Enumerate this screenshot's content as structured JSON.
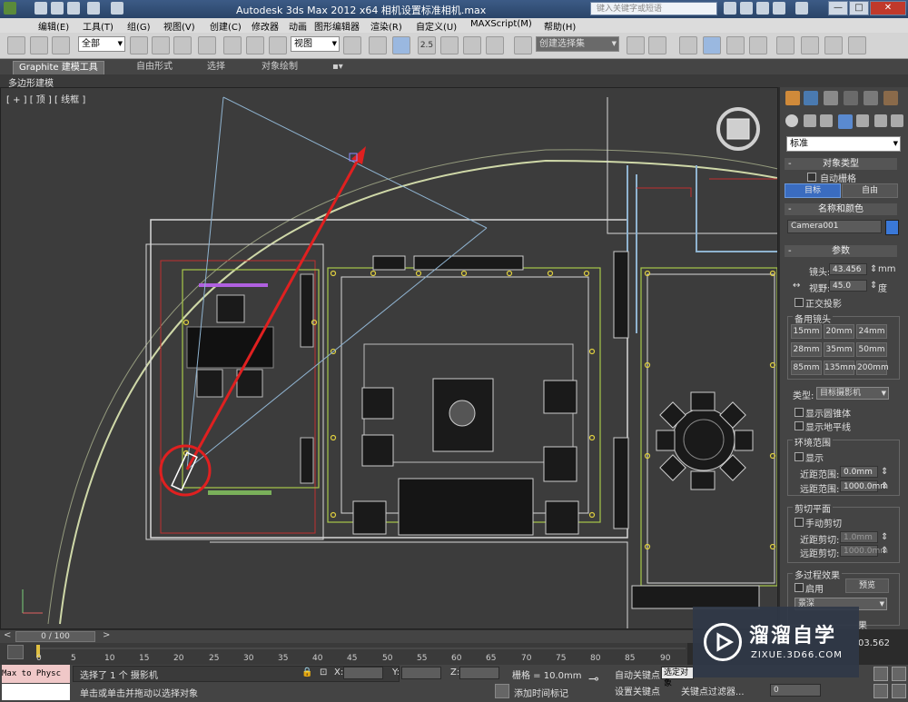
{
  "window": {
    "title": "Autodesk 3ds Max  2012 x64      相机设置标准相机.max",
    "search_placeholder": "键入关键字或短语",
    "controls": [
      "—",
      "□",
      "✕"
    ]
  },
  "menu": [
    "编辑(E)",
    "工具(T)",
    "组(G)",
    "视图(V)",
    "创建(C)",
    "修改器",
    "动画",
    "图形编辑器",
    "渲染(R)",
    "自定义(U)",
    "MAXScript(M)",
    "帮助(H)"
  ],
  "toolbar": {
    "selection_filter": "全部",
    "reference_coord": "视图",
    "snap_angle": "2.5",
    "named_selection": "创建选择集"
  },
  "ribbon": {
    "tabs": [
      "Graphite 建模工具",
      "自由形式",
      "选择",
      "对象绘制"
    ],
    "sub_label": "多边形建模"
  },
  "viewport": {
    "label": "[ + ] [ 顶 ] [ 线框 ]"
  },
  "command_panel": {
    "dropdown": "标准",
    "object_type_header": "对象类型",
    "autogrid": "自动栅格",
    "btn_target": "目标",
    "btn_free": "自由",
    "name_color_header": "名称和颜色",
    "camera_name": "Camera001",
    "params_header": "参数",
    "lens_label": "镜头:",
    "lens_value": "43.456",
    "lens_unit": "mm",
    "fov_label": "视野:",
    "fov_value": "45.0",
    "fov_unit": "度",
    "ortho": "正交投影",
    "stock_lenses": "备用镜头",
    "lenses": [
      "15mm",
      "20mm",
      "24mm",
      "28mm",
      "35mm",
      "50mm",
      "85mm",
      "135mm",
      "200mm"
    ],
    "type_label": "类型:",
    "type_value": "目标摄影机",
    "show_cone": "显示圆锥体",
    "show_horizon": "显示地平线",
    "env_ranges": "环境范围",
    "env_show": "显示",
    "near_range_label": "近距范围:",
    "near_range_value": "0.0mm",
    "far_range_label": "远距范围:",
    "far_range_value": "1000.0mm",
    "clip_planes": "剪切平面",
    "manual_clip": "手动剪切",
    "near_clip_label": "近距剪切:",
    "near_clip_value": "1.0mm",
    "far_clip_label": "远距剪切:",
    "far_clip_value": "1000.0mm",
    "multipass": "多过程效果",
    "enable": "启用",
    "preview": "预览",
    "effect_value": "景深",
    "partial_1": "果",
    "partial_2": "03.562"
  },
  "timeline": {
    "slider": "0 / 100",
    "ticks": [
      "0",
      "5",
      "10",
      "15",
      "20",
      "25",
      "30",
      "35",
      "40",
      "45",
      "50",
      "55",
      "60",
      "65",
      "70",
      "75",
      "80",
      "85",
      "90"
    ]
  },
  "status": {
    "listener": "Max to Physc",
    "selected": "选择了 1 个 摄影机",
    "prompt": "单击或单击并拖动以选择对象",
    "x_label": "X:",
    "y_label": "Y:",
    "z_label": "Z:",
    "grid": "栅格 = 10.0mm",
    "add_time_tag": "添加时间标记",
    "auto_key": "自动关键点",
    "set_key": "设置关键点",
    "selected_obj": "选定对象",
    "key_filters": "关键点过滤器...",
    "frame": "0"
  },
  "watermark": {
    "title": "溜溜自学",
    "url": "ZIXUE.3D66.COM"
  },
  "colors": {
    "camera_red": "#e02020",
    "wall_white": "#d8d8d8",
    "wall_green": "#a8c84a",
    "wall_red": "#c03030",
    "fov_line": "#8fb3d0",
    "target_arc": "#cfd8a8",
    "swatch_blue": "#3a78d8"
  }
}
